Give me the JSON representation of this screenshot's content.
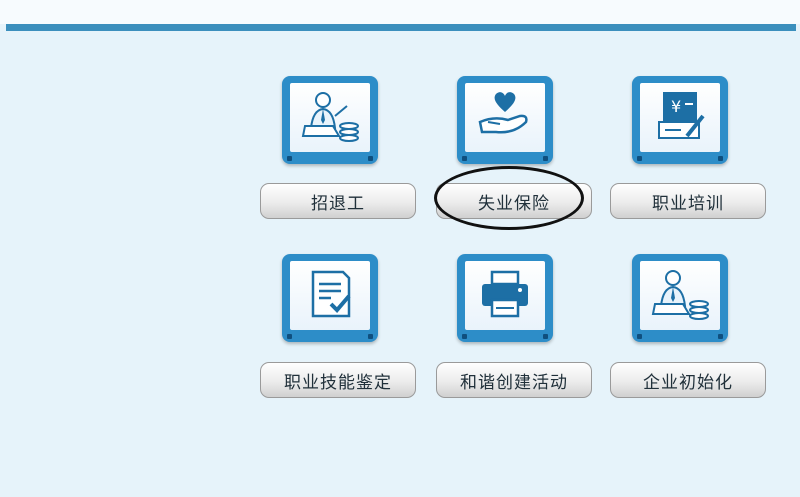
{
  "tiles": [
    {
      "icon": "recruit-person-icon",
      "label": "招退工"
    },
    {
      "icon": "heart-hand-icon",
      "label": "失业保险"
    },
    {
      "icon": "yuan-document-icon",
      "label": "职业培训"
    },
    {
      "icon": "checklist-icon",
      "label": "职业技能鉴定"
    },
    {
      "icon": "printer-icon",
      "label": "和谐创建活动"
    },
    {
      "icon": "business-person-icon",
      "label": "企业初始化"
    }
  ],
  "colors": {
    "header_line": "#3b8fbd",
    "background": "#e6f3fa",
    "tile": "#2d8dc8"
  }
}
